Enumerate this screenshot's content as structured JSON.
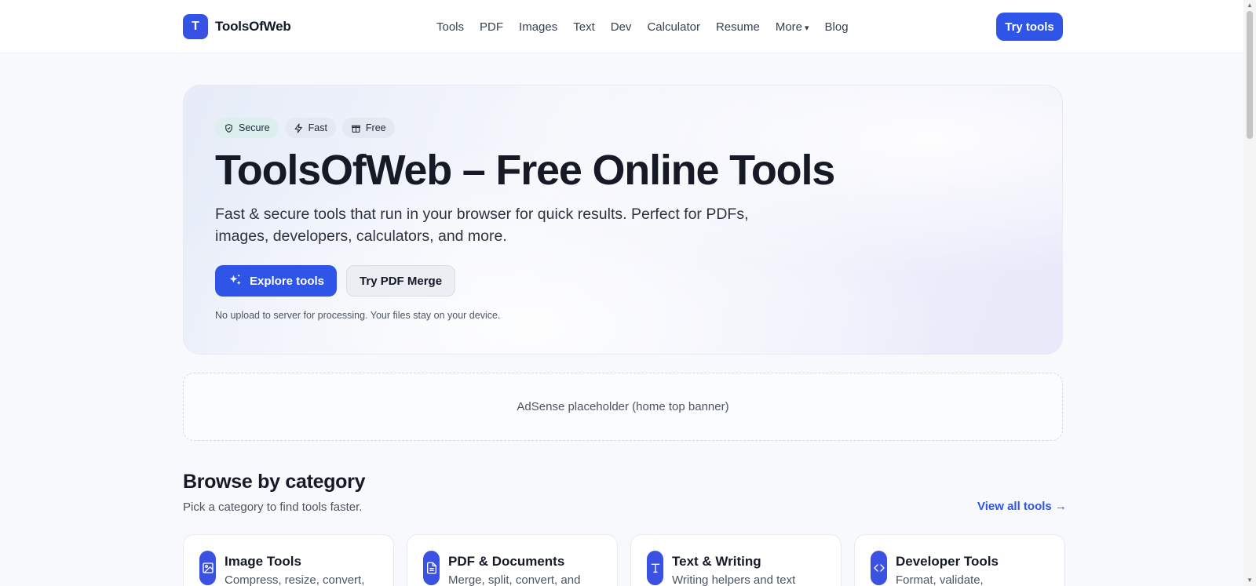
{
  "header": {
    "brand_letter": "T",
    "brand_name": "ToolsOfWeb",
    "nav": [
      "Tools",
      "PDF",
      "Images",
      "Text",
      "Dev",
      "Calculator",
      "Resume",
      "More",
      "Blog"
    ],
    "more_caret": "▾",
    "try_label": "Try tools"
  },
  "hero": {
    "badges": [
      "Secure",
      "Fast",
      "Free"
    ],
    "title": "ToolsOfWeb – Free Online Tools",
    "subtitle": "Fast & secure tools that run in your browser for quick results. Perfect for PDFs, images, developers, calculators, and more.",
    "primary_label": "Explore tools",
    "secondary_label": "Try PDF Merge",
    "note": "No upload to server for processing. Your files stay on your device."
  },
  "ad": {
    "text": "AdSense placeholder (home top banner)"
  },
  "browse": {
    "title": "Browse by category",
    "subtitle": "Pick a category to find tools faster.",
    "view_all": "View all tools →",
    "cards": [
      {
        "title": "Image Tools",
        "desc": "Compress, resize, convert,",
        "icon": "image-icon"
      },
      {
        "title": "PDF & Documents",
        "desc": "Merge, split, convert, and",
        "icon": "document-icon"
      },
      {
        "title": "Text & Writing",
        "desc": "Writing helpers and text",
        "icon": "text-icon"
      },
      {
        "title": "Developer Tools",
        "desc": "Format, validate,",
        "icon": "code-icon"
      }
    ]
  },
  "colors": {
    "accent": "#2f55e8",
    "background": "#f7f9fc"
  }
}
